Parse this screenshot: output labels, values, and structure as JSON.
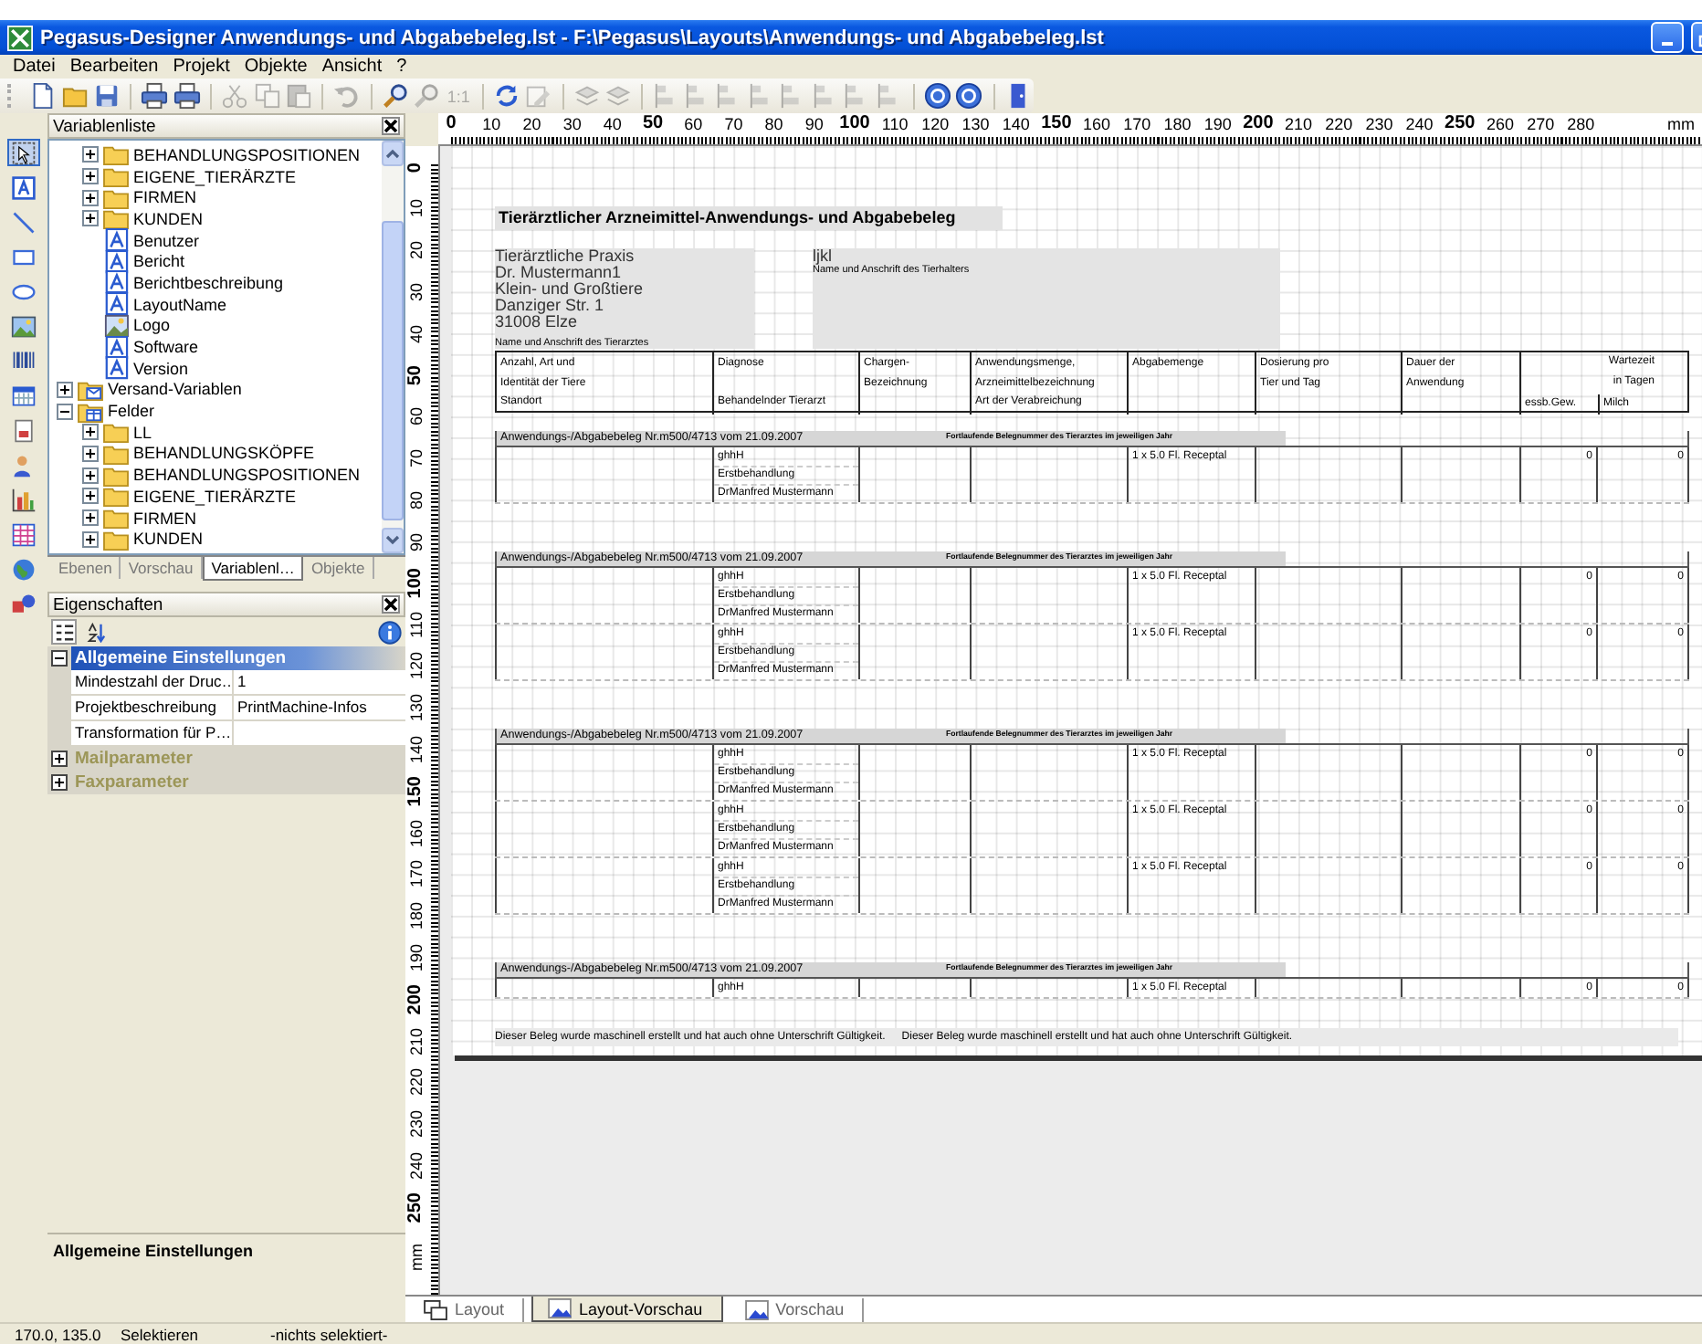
{
  "window": {
    "title": "Pegasus-Designer Anwendungs- und Abgabebeleg.lst - F:\\Pegasus\\Layouts\\Anwendungs- und Abgabebeleg.lst"
  },
  "menu": [
    "Datei",
    "Bearbeiten",
    "Projekt",
    "Objekte",
    "Ansicht",
    "?"
  ],
  "toolbar": [
    [
      {
        "kind": "page",
        "disabled": false
      },
      {
        "kind": "folder",
        "disabled": false
      },
      {
        "kind": "disk",
        "disabled": false
      }
    ],
    [
      {
        "kind": "printer",
        "disabled": false
      },
      {
        "kind": "printer",
        "disabled": false
      }
    ],
    [
      {
        "kind": "scissors",
        "disabled": true
      },
      {
        "kind": "copy",
        "disabled": true
      },
      {
        "kind": "paste",
        "disabled": true
      }
    ],
    [
      {
        "kind": "undo",
        "disabled": true
      }
    ],
    [
      {
        "kind": "zoom",
        "disabled": false
      },
      {
        "kind": "zoom",
        "disabled": true
      },
      {
        "kind": "label",
        "label": "1:1",
        "disabled": true
      }
    ],
    [
      {
        "kind": "refresh",
        "disabled": false
      },
      {
        "kind": "edit",
        "disabled": true
      }
    ],
    [
      {
        "kind": "layers",
        "disabled": true
      },
      {
        "kind": "layers",
        "disabled": true
      }
    ],
    [
      {
        "kind": "align",
        "disabled": true
      },
      {
        "kind": "align",
        "disabled": true
      },
      {
        "kind": "align",
        "disabled": true
      },
      {
        "kind": "align",
        "disabled": true
      },
      {
        "kind": "align",
        "disabled": true
      },
      {
        "kind": "align",
        "disabled": true
      },
      {
        "kind": "align",
        "disabled": true
      },
      {
        "kind": "align",
        "disabled": true
      }
    ],
    [
      {
        "kind": "help",
        "disabled": false
      },
      {
        "kind": "help",
        "disabled": false
      }
    ],
    [
      {
        "kind": "door",
        "disabled": false
      }
    ]
  ],
  "tools": [
    {
      "kind": "select",
      "selected": true
    },
    {
      "kind": "text",
      "selected": false
    },
    {
      "kind": "line",
      "selected": false
    },
    {
      "kind": "rect",
      "selected": false
    },
    {
      "kind": "ellipse",
      "selected": false
    },
    {
      "kind": "image",
      "selected": false
    },
    {
      "kind": "barcode",
      "selected": false
    },
    {
      "kind": "calendar",
      "selected": false
    },
    {
      "kind": "form",
      "selected": false
    },
    {
      "kind": "person",
      "selected": false
    },
    {
      "kind": "chart",
      "selected": false
    },
    {
      "kind": "table",
      "selected": false
    },
    {
      "kind": "globe",
      "selected": false
    },
    {
      "kind": "shapes",
      "selected": false
    }
  ],
  "variable_list": {
    "title": "Variablenliste",
    "continued": [
      {
        "label": "BEHANDLUNGSPOSITIONEN",
        "kind": "folder",
        "expanded": false
      },
      {
        "label": "EIGENE_TIERÄRZTE",
        "kind": "folder",
        "expanded": false
      },
      {
        "label": "FIRMEN",
        "kind": "folder",
        "expanded": false
      },
      {
        "label": "KUNDEN",
        "kind": "folder",
        "expanded": false
      },
      {
        "label": "Benutzer",
        "kind": "text"
      },
      {
        "label": "Bericht",
        "kind": "text"
      },
      {
        "label": "Berichtbeschreibung",
        "kind": "text"
      },
      {
        "label": "LayoutName",
        "kind": "text"
      },
      {
        "label": "Logo",
        "kind": "image"
      },
      {
        "label": "Software",
        "kind": "text"
      },
      {
        "label": "Version",
        "kind": "text"
      }
    ],
    "items": [
      {
        "label": "Versand-Variablen",
        "kind": "mail",
        "expanded": false
      },
      {
        "label": "Felder",
        "kind": "fields",
        "expanded": true,
        "children": [
          {
            "label": "LL",
            "kind": "folder",
            "expanded": false
          },
          {
            "label": "BEHANDLUNGSKÖPFE",
            "kind": "folder",
            "expanded": false
          },
          {
            "label": "BEHANDLUNGSPOSITIONEN",
            "kind": "folder",
            "expanded": false
          },
          {
            "label": "EIGENE_TIERÄRZTE",
            "kind": "folder",
            "expanded": false
          },
          {
            "label": "FIRMEN",
            "kind": "folder",
            "expanded": false
          },
          {
            "label": "KUNDEN",
            "kind": "folder",
            "expanded": false
          }
        ]
      }
    ]
  },
  "panel_tabs": [
    {
      "label": "Ebenen",
      "selected": false
    },
    {
      "label": "Vorschau",
      "selected": false
    },
    {
      "label": "Variablenl…",
      "selected": true
    },
    {
      "label": "Objekte",
      "selected": false
    }
  ],
  "properties": {
    "title": "Eigenschaften",
    "sections": [
      {
        "title": "Allgemeine Einstellungen",
        "expanded": true,
        "selected": true,
        "rows": [
          {
            "name": "Mindestzahl der Druc…",
            "value": "1"
          },
          {
            "name": "Projektbeschreibung",
            "value": "PrintMachine-Infos"
          },
          {
            "name": "Transformation für P…"
          }
        ]
      },
      {
        "title": "Mailparameter",
        "expanded": false,
        "selected": false
      },
      {
        "title": "Faxparameter",
        "expanded": false,
        "selected": false
      }
    ],
    "description": "Allgemeine Einstellungen"
  },
  "ruler_h": [
    "0",
    "10",
    "20",
    "30",
    "40",
    "50",
    "60",
    "70",
    "80",
    "90",
    "100",
    "110",
    "120",
    "130",
    "140",
    "150",
    "160",
    "170",
    "180",
    "190",
    "200",
    "210",
    "220",
    "230",
    "240",
    "250",
    "260",
    "270",
    "280"
  ],
  "ruler_h_unit": "mm",
  "ruler_v": [
    "0",
    "10",
    "20",
    "30",
    "40",
    "50",
    "60",
    "70",
    "80",
    "90",
    "100",
    "110",
    "120",
    "130",
    "140",
    "150",
    "160",
    "170",
    "180",
    "190",
    "200",
    "210",
    "220",
    "230",
    "240",
    "250"
  ],
  "ruler_v_unit": "mm",
  "report": {
    "title": "Tierärztlicher Arzneimittel-Anwendungs- und Abgabebeleg",
    "vet": {
      "lines": [
        "Tierärztliche Praxis",
        "Dr. Mustermann1",
        "Klein- und Großtiere",
        "Danziger Str. 1",
        "31008 Elze"
      ],
      "caption": "Name und Anschrift des Tierarztes"
    },
    "owner": {
      "lines": [
        "ljkl"
      ],
      "caption": "Name und Anschrift des Tierhalters"
    },
    "columns": [
      {
        "lines": [
          "Anzahl, Art und",
          "Identität der Tiere",
          "Standort"
        ]
      },
      {
        "lines": [
          "Diagnose"
        ],
        "bottom": "Behandelnder Tierarzt"
      },
      {
        "lines": [
          "Chargen-",
          "Bezeichnung"
        ]
      },
      {
        "lines": [
          "Anwendungsmenge,",
          "Arzneimittelbezeichnung",
          "Art der Verabreichung"
        ]
      },
      {
        "lines": [
          "Abgabemenge"
        ]
      },
      {
        "lines": [
          "Dosierung pro",
          "Tier und Tag"
        ]
      },
      {
        "lines": [
          "Dauer der",
          "Anwendung"
        ]
      }
    ],
    "waiting": {
      "lines": [
        "Wartezeit",
        "in Tagen"
      ],
      "sub": [
        "essb.Gew.",
        "Milch"
      ]
    },
    "groups": [
      {
        "label": "Anwendungs-/Abgabebeleg Nr.m500/4713 vom 21.09.2007",
        "note": "Fortlaufende Belegnummer des Tierarztes im jeweiligen Jahr",
        "rows": [
          {
            "diagnosis": [
              "ghhH",
              "Erstbehandlung",
              "DrManfred Mustermann"
            ],
            "amount": "1 x 5.0 Fl. Receptal",
            "wait_meat": "0",
            "wait_milk": "0"
          }
        ]
      },
      {
        "label": "Anwendungs-/Abgabebeleg Nr.m500/4713 vom 21.09.2007",
        "note": "Fortlaufende Belegnummer des Tierarztes im jeweiligen Jahr",
        "rows": [
          {
            "diagnosis": [
              "ghhH",
              "Erstbehandlung",
              "DrManfred Mustermann"
            ],
            "amount": "1 x 5.0 Fl. Receptal",
            "wait_meat": "0",
            "wait_milk": "0"
          },
          {
            "diagnosis": [
              "ghhH",
              "Erstbehandlung",
              "DrManfred Mustermann"
            ],
            "amount": "1 x 5.0 Fl. Receptal",
            "wait_meat": "0",
            "wait_milk": "0"
          }
        ]
      },
      {
        "label": "Anwendungs-/Abgabebeleg Nr.m500/4713 vom 21.09.2007",
        "note": "Fortlaufende Belegnummer des Tierarztes im jeweiligen Jahr",
        "rows": [
          {
            "diagnosis": [
              "ghhH",
              "Erstbehandlung",
              "DrManfred Mustermann"
            ],
            "amount": "1 x 5.0 Fl. Receptal",
            "wait_meat": "0",
            "wait_milk": "0"
          },
          {
            "diagnosis": [
              "ghhH",
              "Erstbehandlung",
              "DrManfred Mustermann"
            ],
            "amount": "1 x 5.0 Fl. Receptal",
            "wait_meat": "0",
            "wait_milk": "0"
          },
          {
            "diagnosis": [
              "ghhH",
              "Erstbehandlung",
              "DrManfred Mustermann"
            ],
            "amount": "1 x 5.0 Fl. Receptal",
            "wait_meat": "0",
            "wait_milk": "0"
          }
        ]
      },
      {
        "label": "Anwendungs-/Abgabebeleg Nr.m500/4713 vom 21.09.2007",
        "note": "Fortlaufende Belegnummer des Tierarztes im jeweiligen Jahr",
        "rows": [
          {
            "diagnosis": [
              "ghhH"
            ],
            "amount": "1 x 5.0 Fl. Receptal",
            "wait_meat": "0",
            "wait_milk": "0"
          }
        ]
      }
    ],
    "footer": [
      "Dieser Beleg wurde maschinell erstellt und hat auch ohne Unterschrift Gültigkeit.",
      "Dieser Beleg wurde maschinell erstellt und hat auch ohne Unterschrift Gültigkeit."
    ]
  },
  "view_tabs": [
    {
      "label": "Layout",
      "selected": false
    },
    {
      "label": "Layout-Vorschau",
      "selected": true
    },
    {
      "label": "Vorschau",
      "selected": false
    }
  ],
  "status_bar": [
    "170.0, 135.0",
    "Selektieren",
    "-nichts selektiert-"
  ]
}
